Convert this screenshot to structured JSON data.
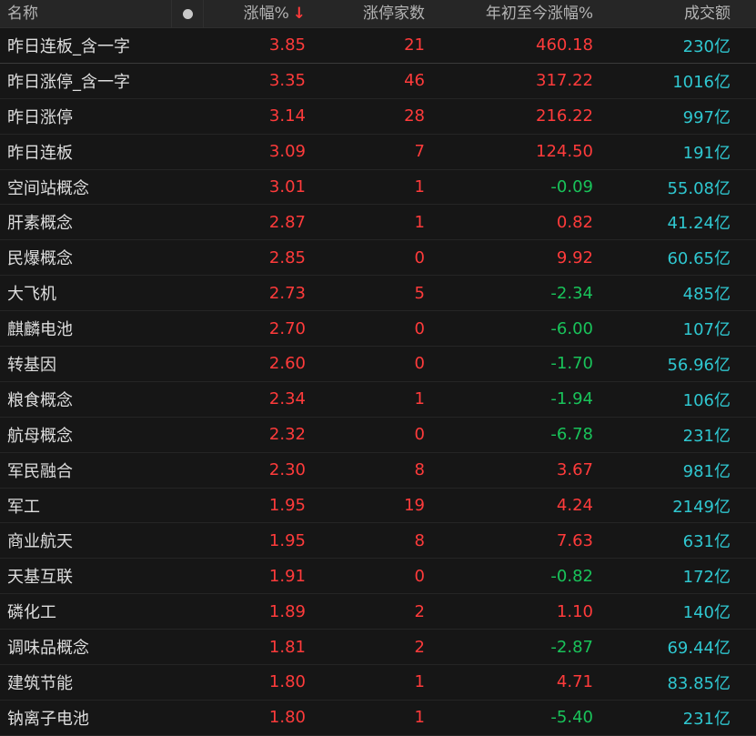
{
  "header": {
    "name": "名称",
    "change": "涨幅%",
    "sort_arrow": "↓",
    "limit_up_count": "涨停家数",
    "ytd_change": "年初至今涨幅%",
    "volume": "成交额"
  },
  "colors": {
    "up": "#ff3b3b",
    "down": "#19c35a",
    "volume": "#2fc7d0",
    "background": "#161616"
  },
  "rows": [
    {
      "name": "昨日连板_含一字",
      "change": "3.85",
      "limit": "21",
      "ytd": "460.18",
      "vol": "230亿"
    },
    {
      "name": "昨日涨停_含一字",
      "change": "3.35",
      "limit": "46",
      "ytd": "317.22",
      "vol": "1016亿"
    },
    {
      "name": "昨日涨停",
      "change": "3.14",
      "limit": "28",
      "ytd": "216.22",
      "vol": "997亿"
    },
    {
      "name": "昨日连板",
      "change": "3.09",
      "limit": "7",
      "ytd": "124.50",
      "vol": "191亿"
    },
    {
      "name": "空间站概念",
      "change": "3.01",
      "limit": "1",
      "ytd": "-0.09",
      "vol": "55.08亿"
    },
    {
      "name": "肝素概念",
      "change": "2.87",
      "limit": "1",
      "ytd": "0.82",
      "vol": "41.24亿"
    },
    {
      "name": "民爆概念",
      "change": "2.85",
      "limit": "0",
      "ytd": "9.92",
      "vol": "60.65亿"
    },
    {
      "name": "大飞机",
      "change": "2.73",
      "limit": "5",
      "ytd": "-2.34",
      "vol": "485亿"
    },
    {
      "name": "麒麟电池",
      "change": "2.70",
      "limit": "0",
      "ytd": "-6.00",
      "vol": "107亿"
    },
    {
      "name": "转基因",
      "change": "2.60",
      "limit": "0",
      "ytd": "-1.70",
      "vol": "56.96亿"
    },
    {
      "name": "粮食概念",
      "change": "2.34",
      "limit": "1",
      "ytd": "-1.94",
      "vol": "106亿"
    },
    {
      "name": "航母概念",
      "change": "2.32",
      "limit": "0",
      "ytd": "-6.78",
      "vol": "231亿"
    },
    {
      "name": "军民融合",
      "change": "2.30",
      "limit": "8",
      "ytd": "3.67",
      "vol": "981亿"
    },
    {
      "name": "军工",
      "change": "1.95",
      "limit": "19",
      "ytd": "4.24",
      "vol": "2149亿"
    },
    {
      "name": "商业航天",
      "change": "1.95",
      "limit": "8",
      "ytd": "7.63",
      "vol": "631亿"
    },
    {
      "name": "天基互联",
      "change": "1.91",
      "limit": "0",
      "ytd": "-0.82",
      "vol": "172亿"
    },
    {
      "name": "磷化工",
      "change": "1.89",
      "limit": "2",
      "ytd": "1.10",
      "vol": "140亿"
    },
    {
      "name": "调味品概念",
      "change": "1.81",
      "limit": "2",
      "ytd": "-2.87",
      "vol": "69.44亿"
    },
    {
      "name": "建筑节能",
      "change": "1.80",
      "limit": "1",
      "ytd": "4.71",
      "vol": "83.85亿"
    },
    {
      "name": "钠离子电池",
      "change": "1.80",
      "limit": "1",
      "ytd": "-5.40",
      "vol": "231亿"
    }
  ]
}
